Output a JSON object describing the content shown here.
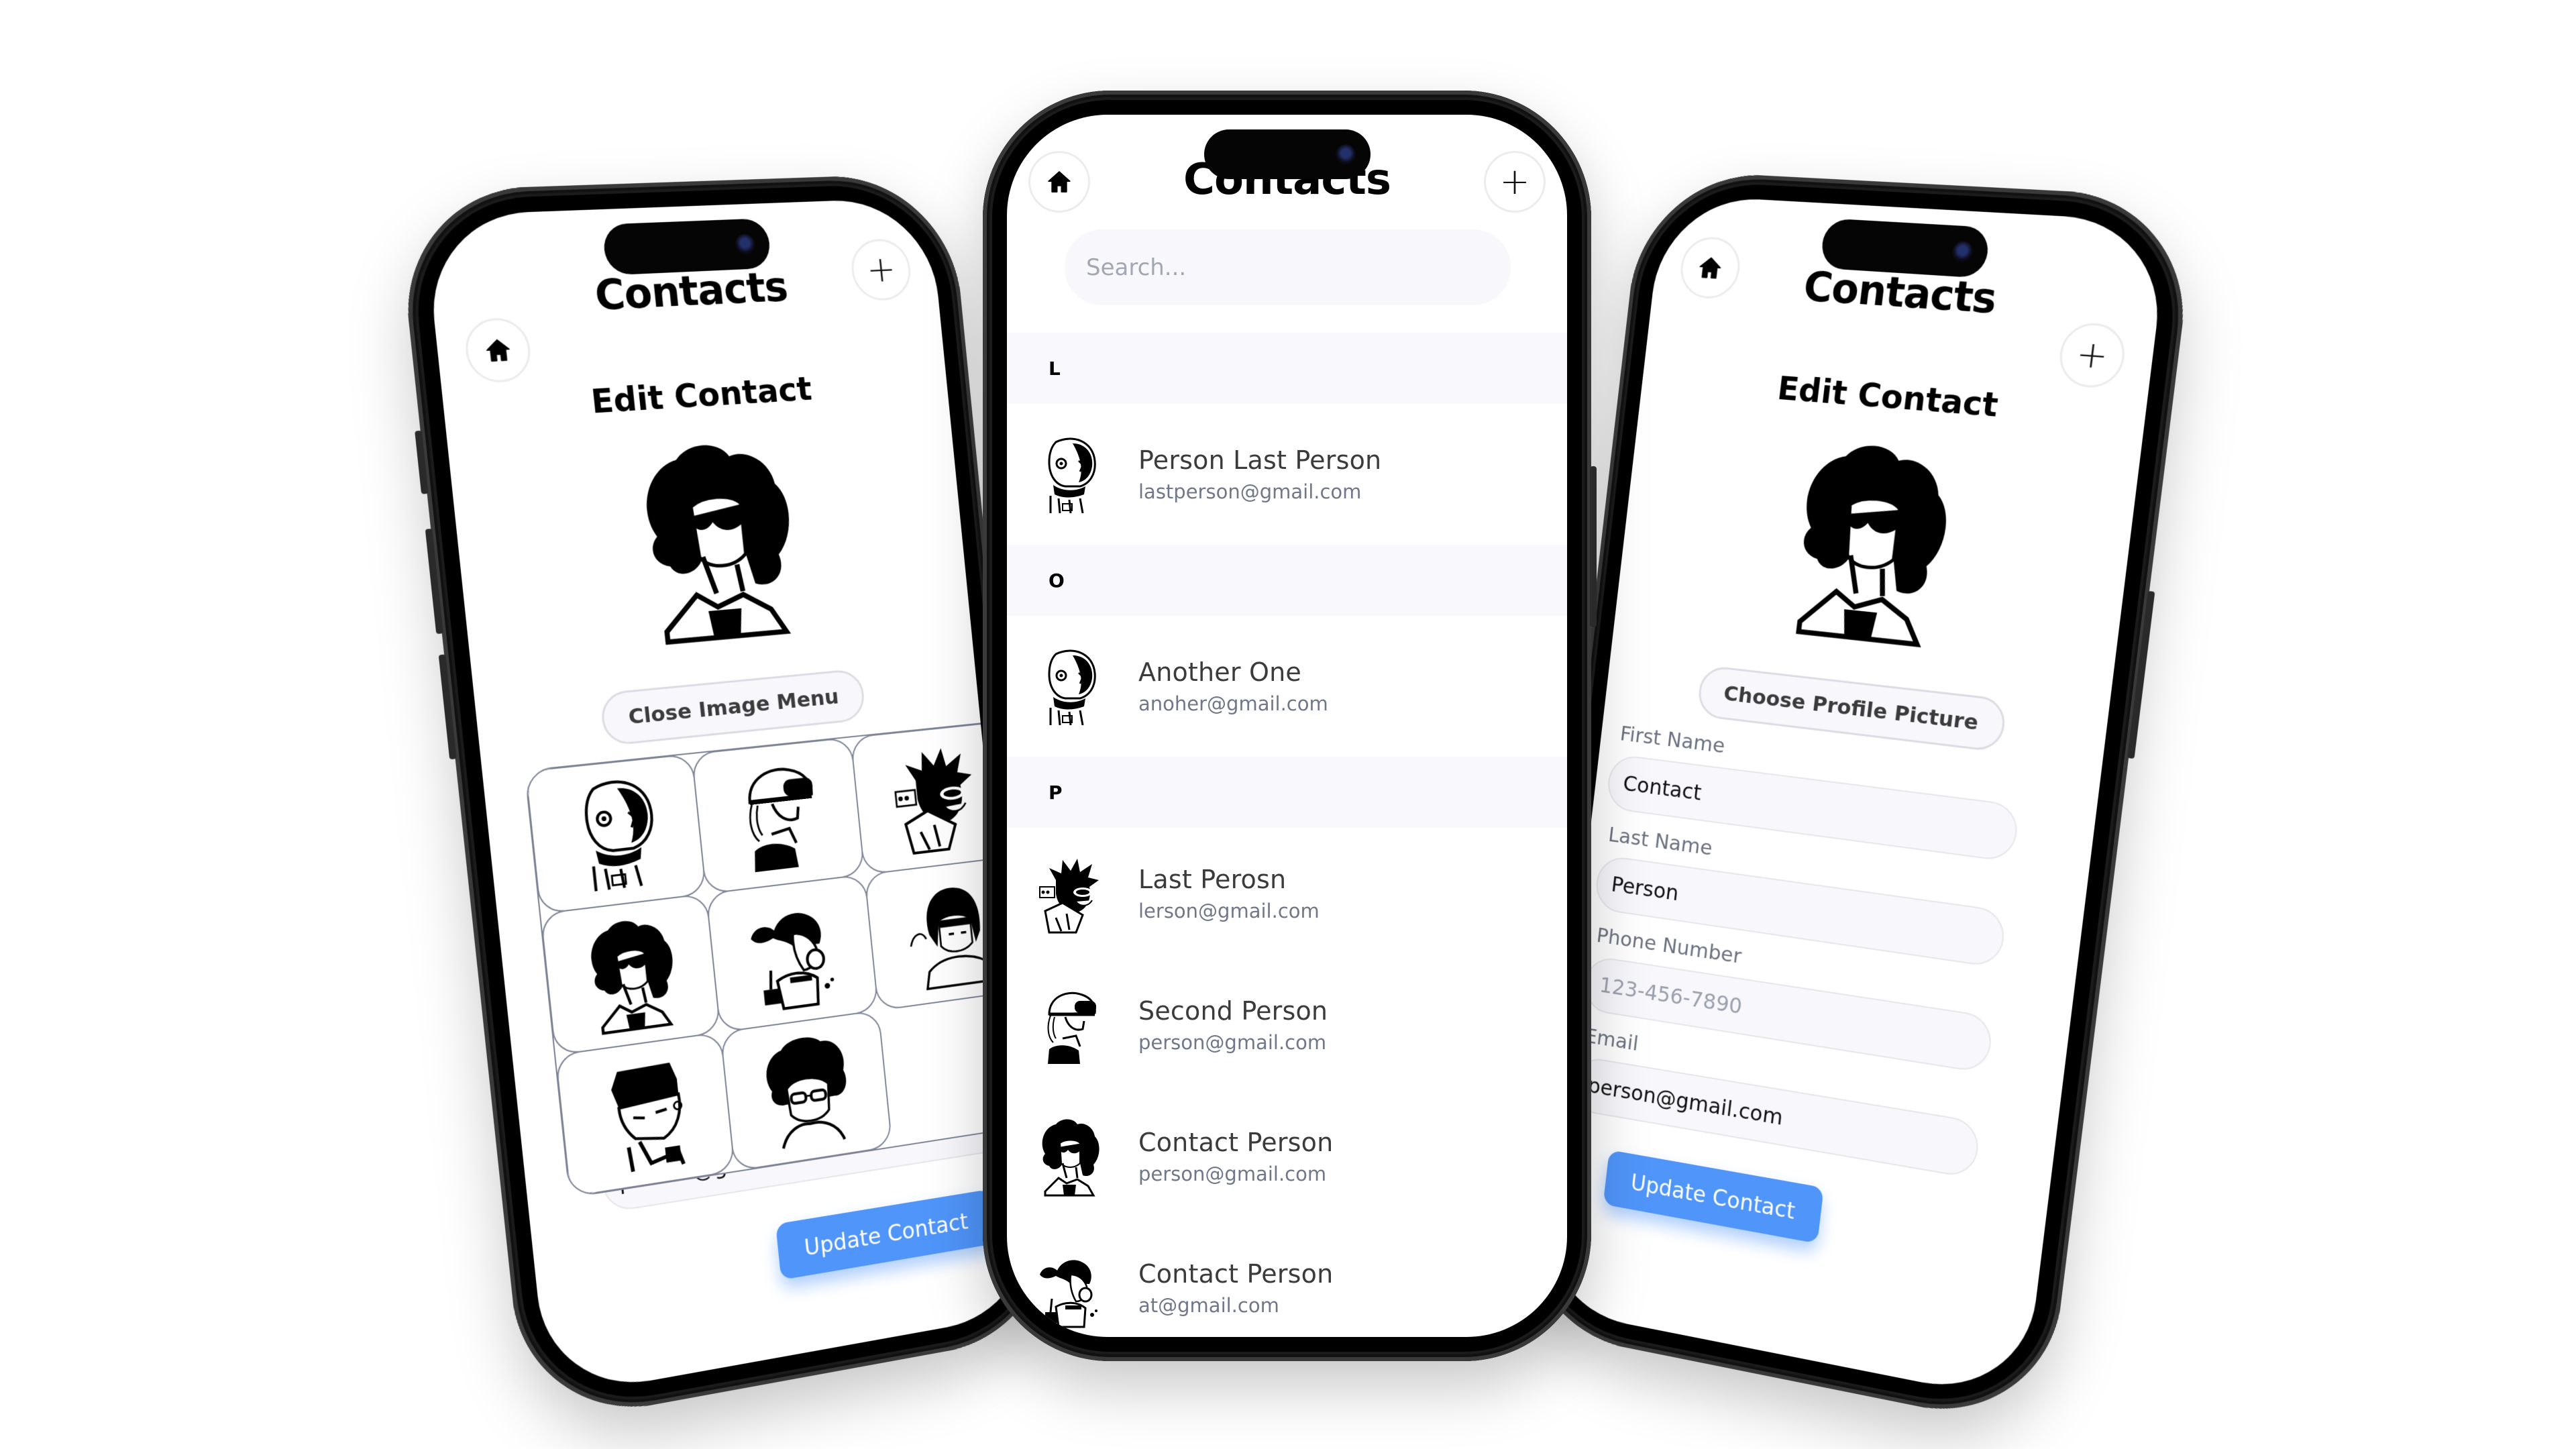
{
  "colors": {
    "accent": "#4f95fa",
    "section_bg": "#f8f8fd",
    "input_bg": "#f7f7fc",
    "name_text": "#3b3b3b",
    "email_text": "#6f7789",
    "placeholder": "#a2a7b4",
    "phone_frame": "#1b1b1b"
  },
  "app": {
    "title": "Contacts",
    "home_icon": "home-icon",
    "add_icon": "plus-icon",
    "add_glyph": "+"
  },
  "center_phone": {
    "search": {
      "placeholder": "Search...",
      "value": ""
    },
    "sections": [
      {
        "letter": "L",
        "contacts": [
          {
            "name": "Person Last Person",
            "email": "lastperson@gmail.com",
            "avatar": "astronaut"
          }
        ]
      },
      {
        "letter": "O",
        "contacts": [
          {
            "name": "Another One",
            "email": "anoher@gmail.com",
            "avatar": "astronaut"
          }
        ]
      },
      {
        "letter": "P",
        "contacts": [
          {
            "name": "Last Perosn",
            "email": "lerson@gmail.com",
            "avatar": "spiky-hair-mask"
          },
          {
            "name": "Second Person",
            "email": "person@gmail.com",
            "avatar": "helmet-goggles"
          },
          {
            "name": "Contact Person",
            "email": "person@gmail.com",
            "avatar": "curly-sunglasses"
          },
          {
            "name": "Contact Person",
            "email": "at@gmail.com",
            "avatar": "ponytail-mask"
          }
        ]
      }
    ]
  },
  "left_phone": {
    "heading": "Edit Contact",
    "avatar": "curly-sunglasses",
    "toggle_label": "Close Image Menu",
    "image_options": [
      "astronaut",
      "helmet-goggles",
      "spiky-hair-mask",
      "curly-sunglasses",
      "ponytail-mask",
      "bob-haircut",
      "flat-top",
      "afro-glasses"
    ],
    "email_value_partial": "person@gmail.com",
    "submit_label": "Update Contact"
  },
  "right_phone": {
    "heading": "Edit Contact",
    "avatar": "curly-sunglasses",
    "choose_label": "Choose Profile Picture",
    "fields": [
      {
        "label": "First Name",
        "value": "Contact",
        "placeholder": ""
      },
      {
        "label": "Last Name",
        "value": "Person",
        "placeholder": ""
      },
      {
        "label": "Phone Number",
        "value": "",
        "placeholder": "123-456-7890"
      },
      {
        "label": "Email",
        "value": "person@gmail.com",
        "placeholder": ""
      }
    ],
    "submit_label": "Update Contact"
  }
}
